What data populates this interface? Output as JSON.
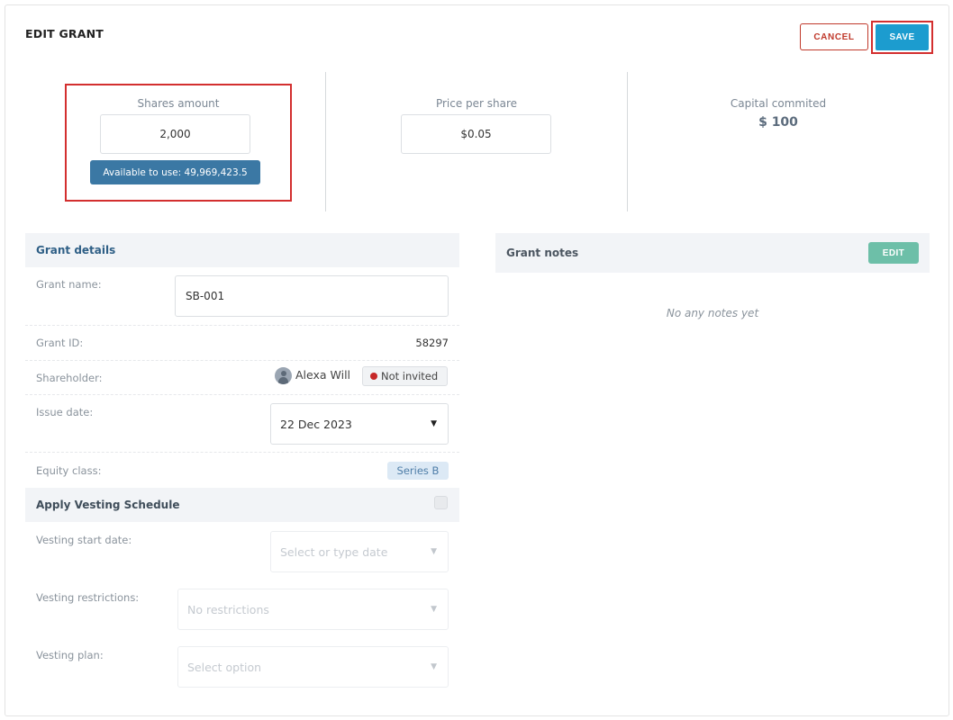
{
  "header": {
    "title": "EDIT GRANT",
    "cancel_label": "CANCEL",
    "save_label": "SAVE"
  },
  "metrics": {
    "shares": {
      "label": "Shares amount",
      "value": "2,000",
      "available": "Available to use: 49,969,423.5"
    },
    "price": {
      "label": "Price per share",
      "value": "$0.05"
    },
    "capital": {
      "label": "Capital commited",
      "value": "$ 100"
    }
  },
  "grant_details": {
    "title": "Grant details",
    "grant_name": {
      "label": "Grant name:",
      "value": "SB-001"
    },
    "grant_id": {
      "label": "Grant ID:",
      "value": "58297"
    },
    "shareholder": {
      "label": "Shareholder:",
      "name": "Alexa Will",
      "status": "Not invited",
      "status_color": "#c62828"
    },
    "issue_date": {
      "label": "Issue date:",
      "value": "22 Dec 2023"
    },
    "equity_class": {
      "label": "Equity class:",
      "value": "Series B"
    }
  },
  "vesting": {
    "title": "Apply Vesting Schedule",
    "start_date": {
      "label": "Vesting start date:",
      "placeholder": "Select or type date"
    },
    "restrictions": {
      "label": "Vesting restrictions:",
      "value": "No restrictions"
    },
    "plan": {
      "label": "Vesting plan:",
      "placeholder": "Select option"
    }
  },
  "notes": {
    "title": "Grant notes",
    "edit_label": "EDIT",
    "empty_text": "No any notes yet"
  },
  "colors": {
    "accent": "#1c9ccf",
    "badge_blue": "#3b78a4",
    "danger": "#c0392b",
    "edit_green": "#6dbfa8"
  }
}
